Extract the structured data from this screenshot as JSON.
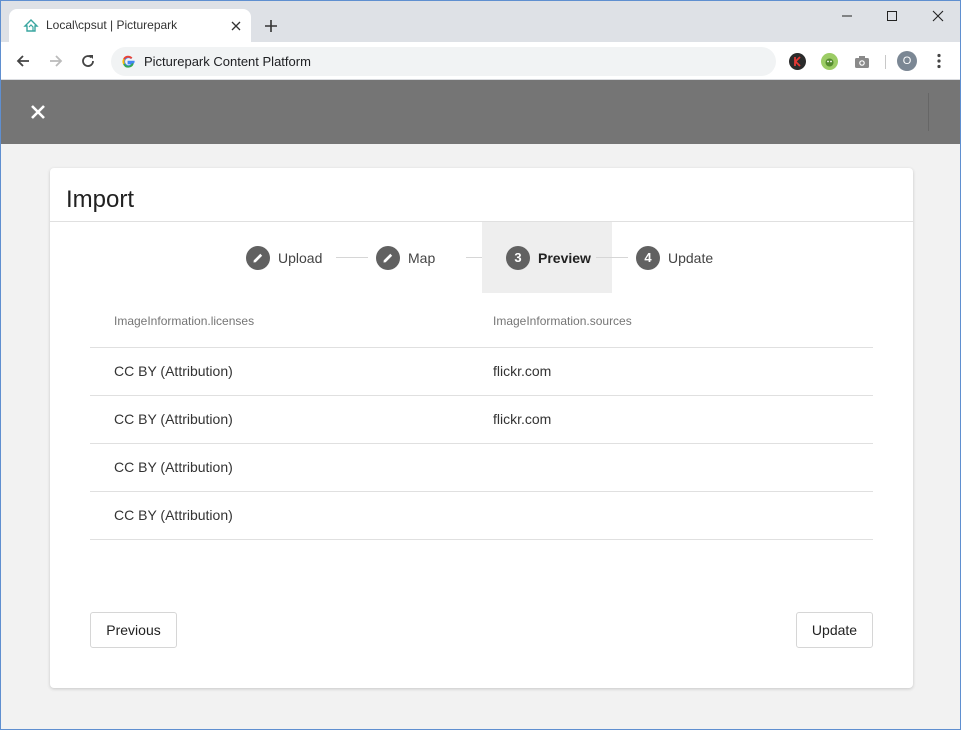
{
  "browser": {
    "tab_title": "Local\\cpsut | Picturepark",
    "address": "Picturepark Content Platform",
    "profile_initial": "O"
  },
  "dialog": {
    "title": "Import",
    "steps": [
      {
        "label": "Upload",
        "marker": "edit-icon"
      },
      {
        "label": "Map",
        "marker": "edit-icon"
      },
      {
        "label": "Preview",
        "marker": "3",
        "active": true
      },
      {
        "label": "Update",
        "marker": "4"
      }
    ],
    "table": {
      "headers": [
        "ImageInformation.licenses",
        "ImageInformation.sources"
      ],
      "rows": [
        [
          "CC BY (Attribution)",
          "flickr.com"
        ],
        [
          "CC BY (Attribution)",
          "flickr.com"
        ],
        [
          "CC BY (Attribution)",
          ""
        ],
        [
          "CC BY (Attribution)",
          ""
        ]
      ]
    },
    "buttons": {
      "previous": "Previous",
      "update": "Update"
    }
  },
  "colors": {
    "header_bg": "#757575",
    "step_circle": "#616161",
    "active_step_bg": "#eeeeee"
  }
}
